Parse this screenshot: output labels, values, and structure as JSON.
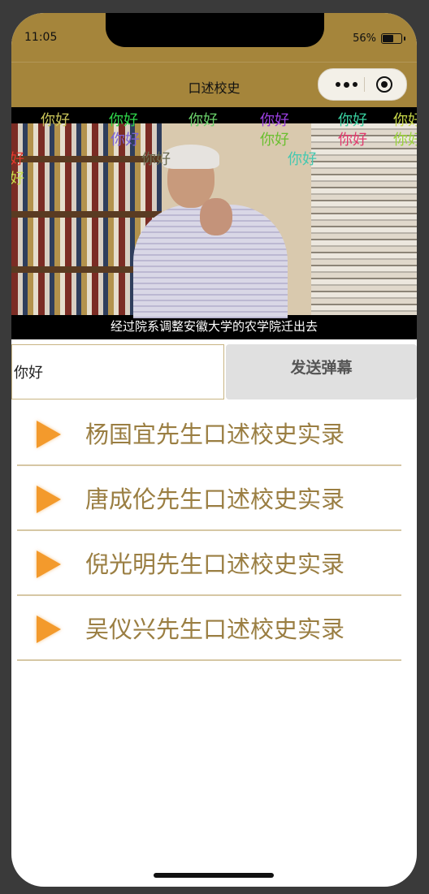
{
  "status_bar": {
    "time": "11:05",
    "battery": "56%"
  },
  "nav": {
    "title": "口述校史"
  },
  "video": {
    "subtitle": "经过院系调整安徽大学的农学院迁出去",
    "danmaku": [
      {
        "text": "你好",
        "color": "#c9c45a"
      },
      {
        "text": "你好",
        "color": "#2fd44a"
      },
      {
        "text": "你好",
        "color": "#6ad06a"
      },
      {
        "text": "你好",
        "color": "#9b3fe0"
      },
      {
        "text": "你好",
        "color": "#39d0a0"
      },
      {
        "text": "你好",
        "color": "#c8d84a"
      },
      {
        "text": "你好",
        "color": "#7a62d8"
      },
      {
        "text": "你好",
        "color": "#6abf2f"
      },
      {
        "text": "你好",
        "color": "#e23a6e"
      },
      {
        "text": "你好",
        "color": "#9ad33a"
      },
      {
        "text": "你好",
        "color": "#6b6b50"
      },
      {
        "text": "你好",
        "color": "#45c8b0"
      },
      {
        "text": "好",
        "color": "#e8372e"
      },
      {
        "text": "好",
        "color": "#c8e04a"
      }
    ]
  },
  "danmu_input": {
    "value": "你好"
  },
  "send_button": {
    "label": "发送弹幕"
  },
  "list": [
    {
      "title": "杨国宜先生口述校史实录"
    },
    {
      "title": "唐成伦先生口述校史实录"
    },
    {
      "title": "倪光明先生口述校史实录"
    },
    {
      "title": "吴仪兴先生口述校史实录"
    }
  ],
  "colors": {
    "header": "#a5853b",
    "list_text": "#9a7e42",
    "play_icon": "#f39a2c",
    "divider": "#d6c7a4"
  }
}
